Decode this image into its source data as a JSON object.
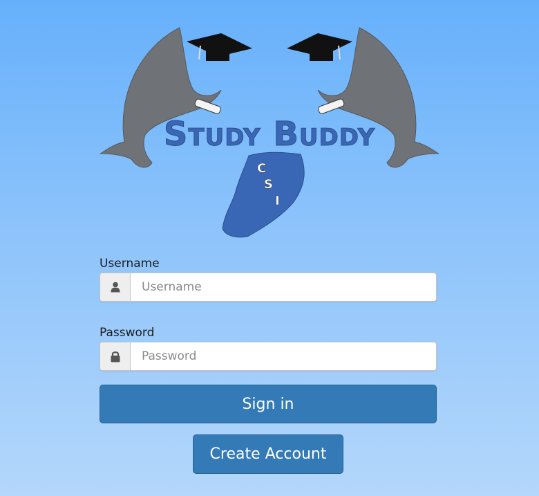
{
  "logo": {
    "name": "Study Buddy",
    "map_letters": [
      "C",
      "S",
      "I"
    ],
    "colors": {
      "dolphin": "#6f7277",
      "text": "#3a67b5",
      "island": "#3a67b5"
    }
  },
  "login_form": {
    "username_label": "Username",
    "username_placeholder": "Username",
    "username_icon": "user-icon",
    "password_label": "Password",
    "password_placeholder": "Password",
    "password_icon": "lock-icon",
    "signin_label": "Sign in",
    "create_account_label": "Create Account"
  },
  "colors": {
    "primary_button": "#337ab7",
    "background_top": "#66b0fb",
    "background_bottom": "#b4d7fb"
  }
}
